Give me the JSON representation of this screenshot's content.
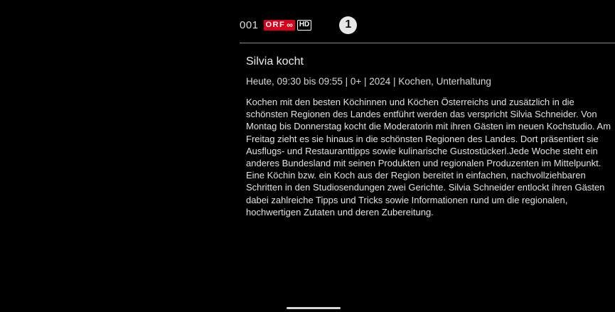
{
  "channel": {
    "number": "001",
    "logo_text": "ORF",
    "logo_symbol": "∞",
    "hd_label": "HD",
    "brand_color": "#d9001c"
  },
  "age_rating": {
    "label": "1"
  },
  "program": {
    "title": "Silvia kocht",
    "meta": "Heute, 09:30 bis 09:55 | 0+ | 2024 | Kochen, Unterhaltung",
    "description": "Kochen mit den besten Köchinnen und Köchen Österreichs und zusätzlich in die schönsten Regionen des Landes entführt werden das verspricht Silvia Schneider. Von Montag bis Donnerstag kocht die Moderatorin mit ihren Gästen im neuen Kochstudio. Am Freitag zieht es sie hinaus in die schönsten Regionen des Landes. Dort präsentiert sie Ausflugs- und Restauranttipps sowie kulinarische Gustostückerl.Jede Woche steht ein anderes Bundesland mit seinen Produkten und regionalen Produzenten im Mittelpunkt. Eine Köchin bzw. ein Koch aus der Region bereitet in einfachen, nachvollziehbaren Schritten in den Studiosendungen zwei Gerichte. Silvia Schneider entlockt ihren Gästen dabei zahlreiche Tipps und Tricks sowie Informationen rund um die regionalen, hochwertigen Zutaten und deren Zubereitung."
  },
  "icons": {
    "channel_logo": "orf-logo-icon",
    "hd": "hd-badge-icon",
    "rating": "age-rating-icon"
  }
}
